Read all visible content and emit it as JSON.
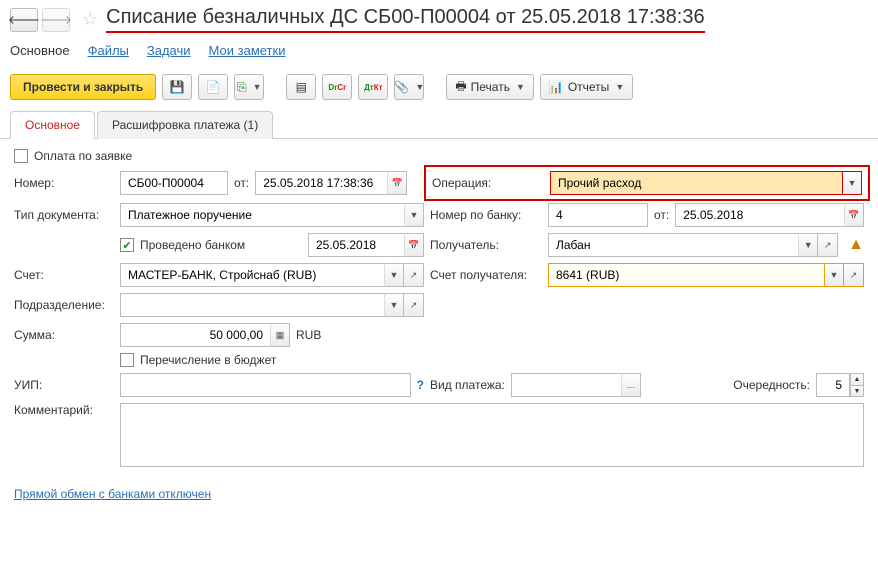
{
  "title": "Списание безналичных ДС СБ00-П00004 от 25.05.2018 17:38:36",
  "nav": {
    "main": "Основное",
    "files": "Файлы",
    "tasks": "Задачи",
    "notes": "Мои заметки"
  },
  "toolbar": {
    "submit_close": "Провести и закрыть",
    "print": "Печать",
    "reports": "Отчеты"
  },
  "tabs": {
    "main": "Основное",
    "detail": "Расшифровка платежа (1)"
  },
  "form": {
    "pay_by_request": "Оплата по заявке",
    "number_label": "Номер:",
    "number": "СБ00-П00004",
    "from": "от:",
    "datetime": "25.05.2018 17:38:36",
    "operation_label": "Операция:",
    "operation": "Прочий расход",
    "doc_type_label": "Тип документа:",
    "doc_type": "Платежное поручение",
    "bank_num_label": "Номер по банку:",
    "bank_num": "4",
    "bank_date": "25.05.2018",
    "bank_done": "Проведено банком",
    "bank_done_date": "25.05.2018",
    "recipient_label": "Получатель:",
    "recipient": "Лабан",
    "account_label": "Счет:",
    "account": "МАСТЕР-БАНК, Стройснаб (RUB)",
    "recip_acc_label": "Счет получателя:",
    "recip_acc": "8641 (RUB)",
    "dept_label": "Подразделение:",
    "sum_label": "Сумма:",
    "sum": "50 000,00",
    "currency": "RUB",
    "budget": "Перечисление в бюджет",
    "uip_label": "УИП:",
    "pay_type_label": "Вид платежа:",
    "order_label": "Очередность:",
    "order": "5",
    "comment_label": "Комментарий:"
  },
  "footer": "Прямой обмен с банками отключен"
}
